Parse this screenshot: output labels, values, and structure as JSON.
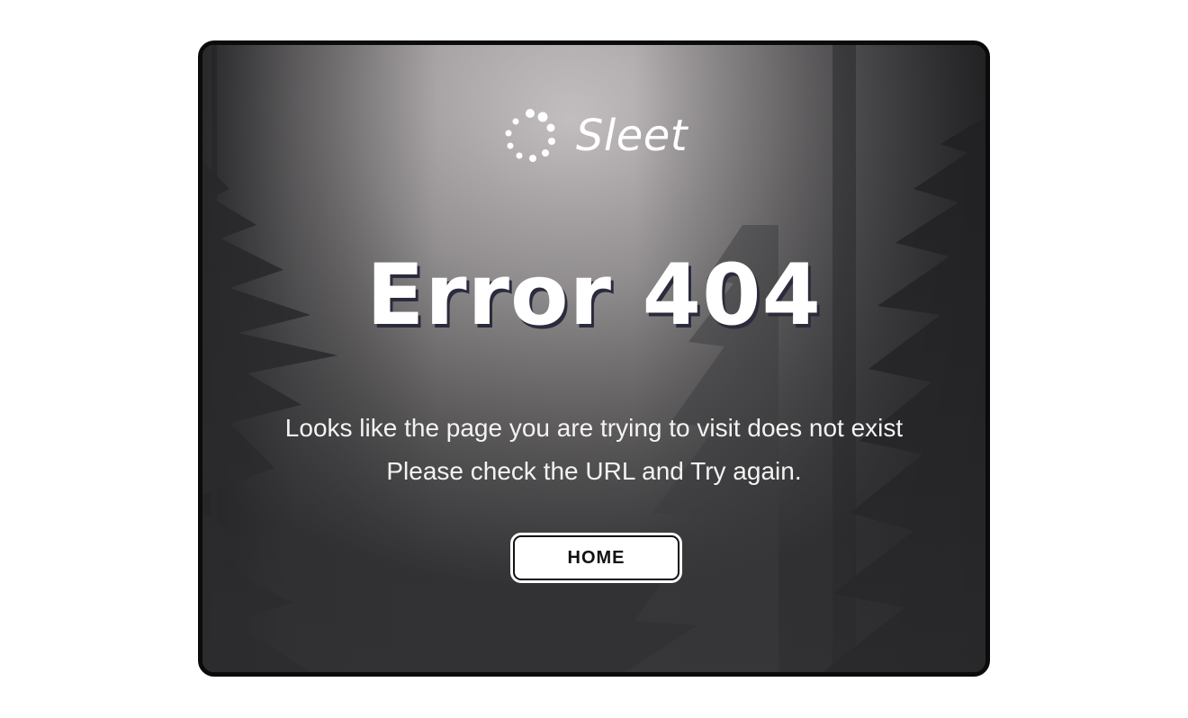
{
  "logo": {
    "brand_name": "Sleet",
    "icon": "dotted-circle-logo-icon"
  },
  "error": {
    "title": "Error 404",
    "message_line1": "Looks like the page you are trying to visit does not exist",
    "message_line2": "Please check the URL and Try again."
  },
  "actions": {
    "home_label": "HOME"
  },
  "colors": {
    "text": "#ffffff",
    "frame_border": "#0b0b0b",
    "title_shadow": "#2b2b3d",
    "button_bg": "#ffffff",
    "button_text": "#111111"
  },
  "background": {
    "description_icon": "foggy-forest-background"
  }
}
